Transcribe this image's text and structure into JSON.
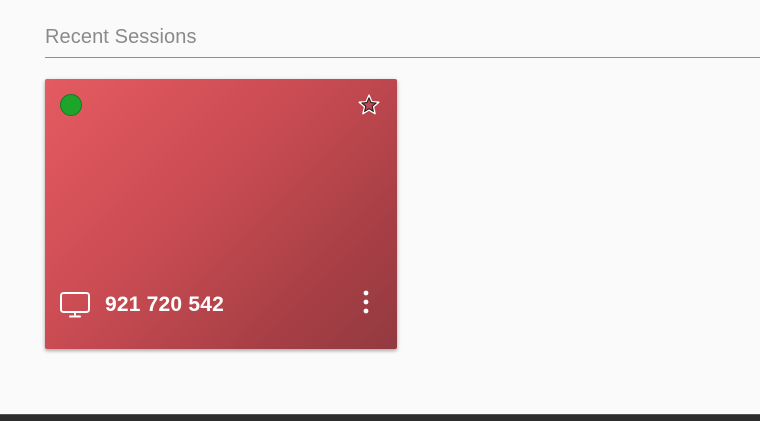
{
  "section": {
    "title": "Recent Sessions"
  },
  "session": {
    "id_label": "921 720 542",
    "status_icon": "online-status-dot",
    "status_color": "#1ca42b",
    "favorite_icon": "star-outline-icon",
    "device_icon": "monitor-icon",
    "menu_icon": "more-vertical-icon",
    "card_color": "#d7525a"
  }
}
